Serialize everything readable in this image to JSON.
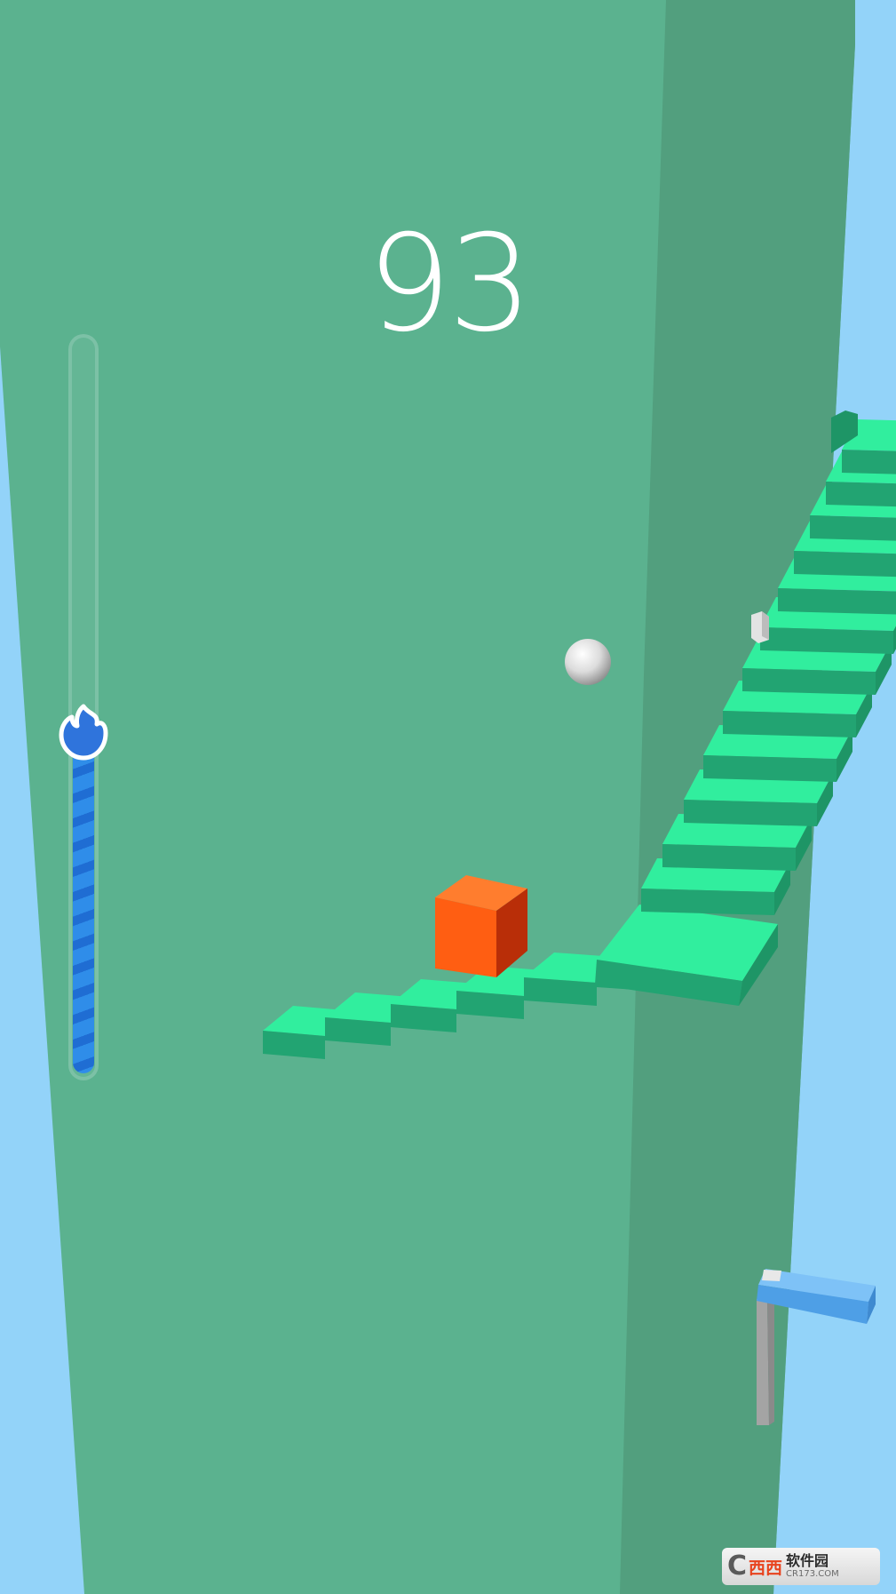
{
  "game": {
    "score": "93",
    "progress_fraction": 0.47
  },
  "watermark": {
    "brand": "西西",
    "name": "软件园",
    "url": "CR173.COM"
  },
  "colors": {
    "sky": "#93d3f9",
    "tower": "#5bb28f",
    "tower_shade": "#529f7e",
    "step_top": "#31ee9e",
    "step_front": "#22a472",
    "box_front": "#ff5e12",
    "box_side": "#b92e08",
    "progress_fill": "#2f8de9"
  },
  "icons": {
    "progress_marker": "flame-icon",
    "player": "ball",
    "obstacle": "cube"
  }
}
